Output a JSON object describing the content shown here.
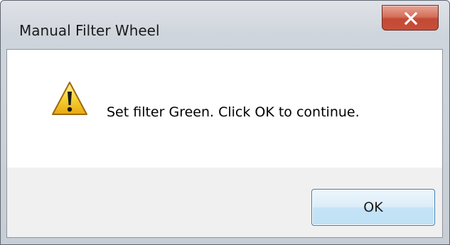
{
  "window": {
    "title": "Manual Filter Wheel",
    "close_icon": "close-x-icon"
  },
  "message": {
    "icon": "warning-triangle-icon",
    "text": "Set filter Green.  Click OK to continue."
  },
  "buttons": {
    "ok_label": "OK"
  },
  "colors": {
    "close_button": "#c84e39",
    "ok_button_border": "#3c7fb1",
    "warning_yellow": "#f5c518",
    "button_area": "#f0f0f0"
  }
}
